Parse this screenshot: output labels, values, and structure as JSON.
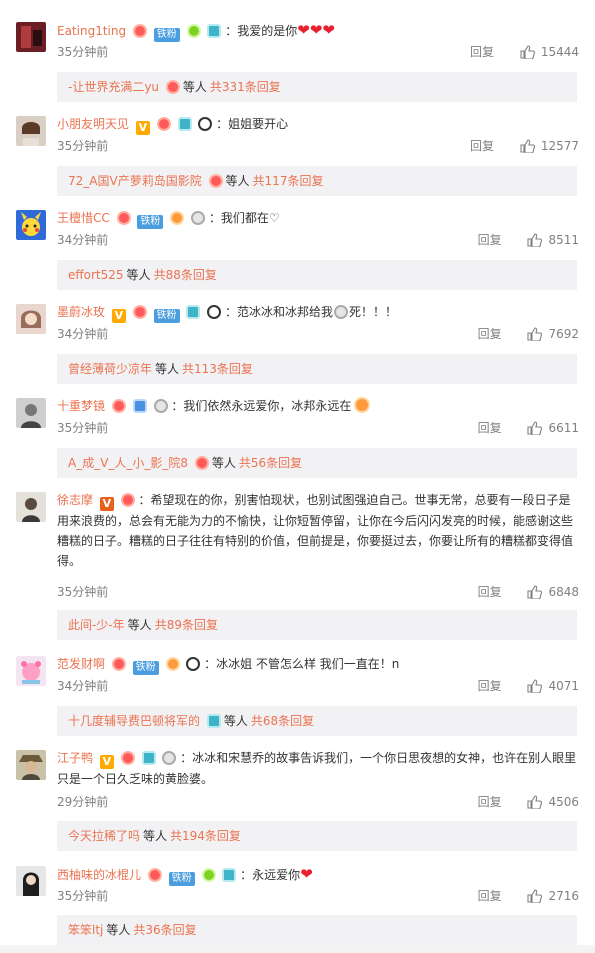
{
  "labels": {
    "reply": "回复",
    "etc": "等人",
    "fan": "铁粉"
  },
  "comments": [
    {
      "user": "Eating1ting",
      "text": "我爱的是你",
      "hearts": "❤❤❤",
      "time": "35分钟前",
      "likes": "15444",
      "reply_user": "-让世界充满二yu",
      "reply_total": "共331条回复"
    },
    {
      "user": "小朋友明天见",
      "text": "姐姐要开心",
      "hearts": "",
      "time": "35分钟前",
      "likes": "12577",
      "reply_user": "72_A国V产萝莉岛国影院",
      "reply_total": "共117条回复"
    },
    {
      "user": "王檀惜CC",
      "text": "我们都在♡",
      "hearts": "",
      "time": "34分钟前",
      "likes": "8511",
      "reply_user": "effort525",
      "reply_total": "共88条回复"
    },
    {
      "user": "墨蔚冰玫",
      "text": "范冰冰和冰邦给我",
      "text2": "死！！！",
      "hearts": "",
      "time": "34分钟前",
      "likes": "7692",
      "reply_user": "曾经薄荷少凉年",
      "reply_total": "共113条回复"
    },
    {
      "user": "十重梦镜",
      "text": "我们依然永远爱你，冰邦永远在",
      "hearts": "",
      "time": "35分钟前",
      "likes": "6611",
      "reply_user": "A_成_V_人_小_影_院8",
      "reply_total": "共56条回复"
    },
    {
      "user": "徐志摩",
      "text": "希望现在的你，别害怕现状，也别试图强迫自己。世事无常，总要有一段日子是用来浪费的，总会有无能为力的不愉快，让你短暂停留，让你在今后闪闪发亮的时候，能感谢这些糟糕的日子。糟糕的日子往往有特别的价值，但前提是，你要挺过去，你要让所有的糟糕都变得值得。",
      "hearts": "",
      "time": "35分钟前",
      "likes": "6848",
      "reply_user": "此间-少-年",
      "reply_total": "共89条回复"
    },
    {
      "user": "范发财啊",
      "text": "冰冰姐 不管怎么样 我们一直在！n",
      "hearts": "",
      "time": "34分钟前",
      "likes": "4071",
      "reply_user": "十几度辅导费巴顿将军的",
      "reply_total": "共68条回复"
    },
    {
      "user": "江子鸭",
      "text": "冰冰和宋慧乔的故事告诉我们，一个你日思夜想的女神，也许在别人眼里只是一个日久乏味的黄脸婆。",
      "hearts": "",
      "time": "29分钟前",
      "likes": "4506",
      "reply_user": "今天拉稀了吗",
      "reply_total": "共194条回复"
    },
    {
      "user": "西柚味的冰棍儿",
      "text": "永远爱你",
      "hearts": "❤",
      "time": "35分钟前",
      "likes": "2716",
      "reply_user": "笨笨ltj",
      "reply_total": "共36条回复"
    }
  ]
}
